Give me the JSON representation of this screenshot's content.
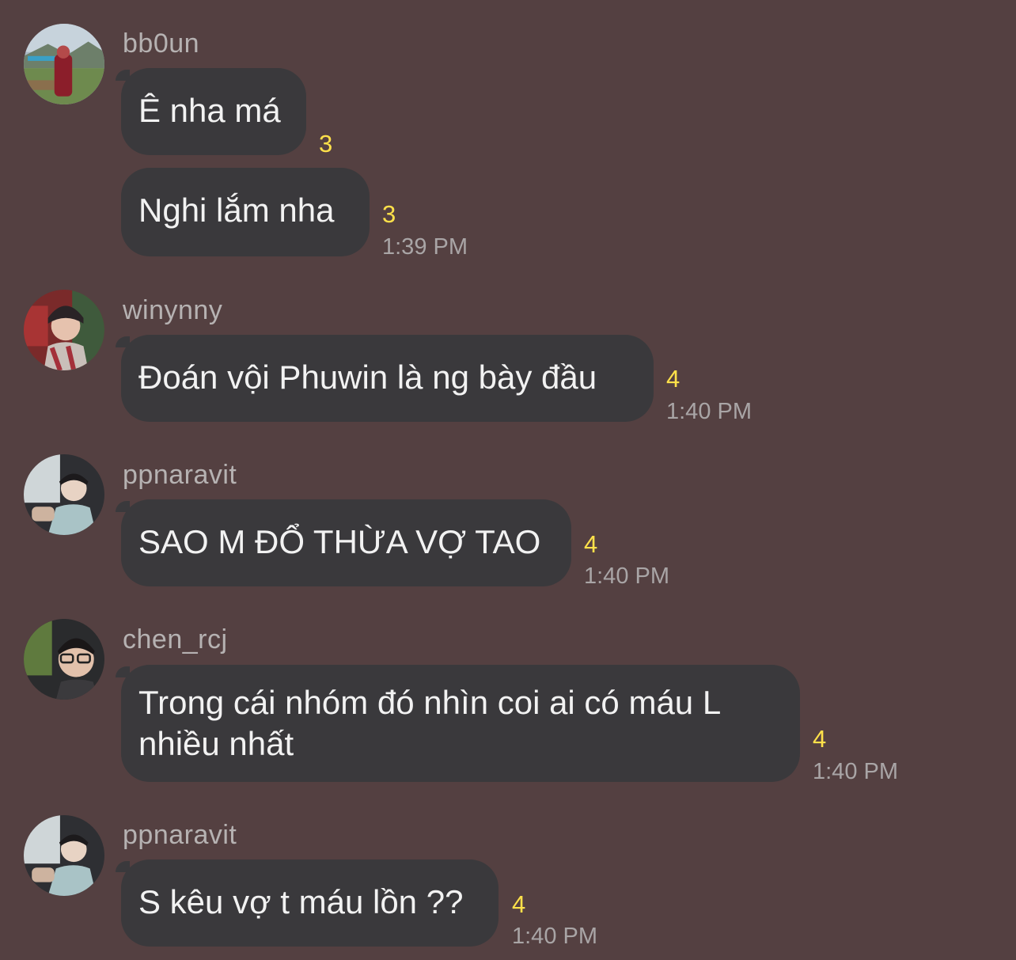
{
  "messages": [
    {
      "sender": "bb0un",
      "bubbles": [
        {
          "text": "Ê nha má",
          "count": "3"
        },
        {
          "text": "Nghi lắm nha",
          "count": "3",
          "time": "1:39 PM"
        }
      ]
    },
    {
      "sender": "winynny",
      "bubbles": [
        {
          "text": "Đoán vội Phuwin là ng bày đầu",
          "count": "4",
          "time": "1:40 PM"
        }
      ]
    },
    {
      "sender": "ppnaravit",
      "bubbles": [
        {
          "text": "SAO M ĐỔ THỪA VỢ TAO",
          "count": "4",
          "time": "1:40 PM"
        }
      ]
    },
    {
      "sender": "chen_rcj",
      "bubbles": [
        {
          "text": "Trong cái nhóm đó nhìn coi ai có máu L nhiều nhất",
          "count": "4",
          "time": "1:40 PM"
        }
      ]
    },
    {
      "sender": "ppnaravit",
      "bubbles": [
        {
          "text": "S kêu vợ t máu lồn ??",
          "count": "4",
          "time": "1:40 PM"
        }
      ]
    }
  ]
}
